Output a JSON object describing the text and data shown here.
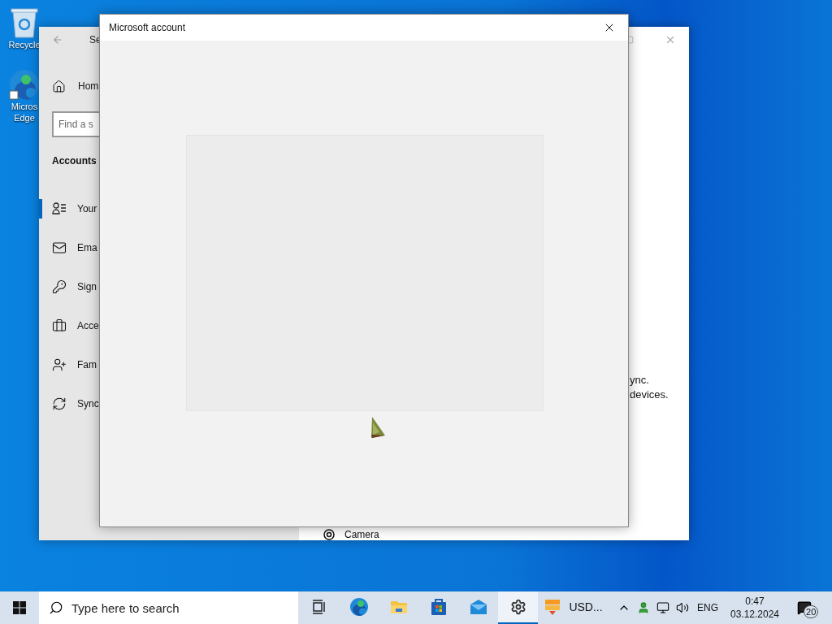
{
  "desktop_icons": [
    {
      "kind": "recycle",
      "lines": [
        "Recycle"
      ]
    },
    {
      "kind": "edge",
      "lines": [
        "Micros",
        "Edge"
      ]
    }
  ],
  "settings_window": {
    "title": "Se",
    "home": "Hom",
    "search": {
      "placeholder": "Find a s"
    },
    "section": "Accounts",
    "nav": [
      {
        "kind": "info",
        "label": "Your",
        "selected": true
      },
      {
        "kind": "mail",
        "label": "Ema",
        "selected": false
      },
      {
        "kind": "key",
        "label": "Sign",
        "selected": false
      },
      {
        "kind": "work",
        "label": "Acce",
        "selected": false
      },
      {
        "kind": "family",
        "label": "Fam",
        "selected": false
      },
      {
        "kind": "sync",
        "label": "Sync",
        "selected": false
      }
    ],
    "content_lines": [
      "ync.",
      "devices."
    ],
    "camera": "Camera"
  },
  "dialog": {
    "title": "Microsoft account"
  },
  "taskbar": {
    "search": {
      "placeholder": "Type here to search"
    },
    "apps": [
      {
        "kind": "taskview",
        "selected": false
      },
      {
        "kind": "edge",
        "selected": false
      },
      {
        "kind": "folder",
        "selected": false
      },
      {
        "kind": "store",
        "selected": false
      },
      {
        "kind": "mail",
        "selected": false
      },
      {
        "kind": "settings",
        "selected": true
      },
      {
        "kind": "usd",
        "label": "USD...",
        "selected": false
      }
    ],
    "language": "ENG",
    "time": "0:47",
    "date": "03.12.2024",
    "notifications": "20"
  }
}
